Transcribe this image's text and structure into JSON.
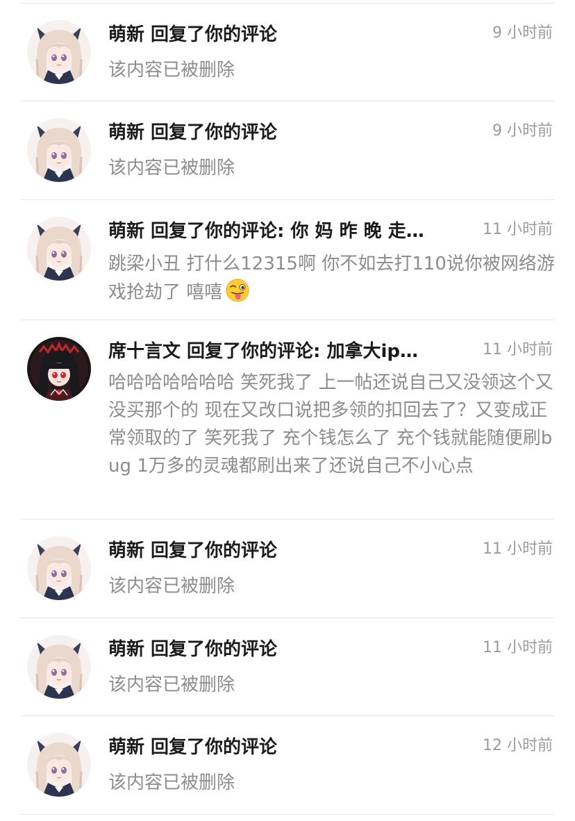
{
  "notifications": [
    {
      "title": "萌新 回复了你的评论",
      "time": "9 小时前",
      "body": "该内容已被删除",
      "avatar": "anime-girl-white-hair-avatar"
    },
    {
      "title": "萌新 回复了你的评论",
      "time": "9 小时前",
      "body": "该内容已被删除",
      "avatar": "anime-girl-white-hair-avatar"
    },
    {
      "title": "萌新 回复了你的评论: 你 妈 昨 晚 走…",
      "time": "11 小时前",
      "body": "跳梁小丑 打什么12315啊 你不如去打110说你被网络游戏抢劫了 嘻嘻",
      "emoji": "winking-tongue-emoji",
      "avatar": "anime-girl-white-hair-avatar"
    },
    {
      "title": "席十言文 回复了你的评论: 加拿大ip…",
      "time": "11 小时前",
      "body": "哈哈哈哈哈哈哈 笑死我了 上一帖还说自己又没领这个又没买那个的 现在又改口说把多领的扣回去了？又变成正常领取的了 笑死我了 充个钱怎么了 充个钱就能随便刷bug 1万多的灵魂都刷出来了还说自己不小心点",
      "avatar": "anime-girl-black-hair-avatar"
    },
    {
      "title": "萌新 回复了你的评论",
      "time": "11 小时前",
      "body": "该内容已被删除",
      "avatar": "anime-girl-white-hair-avatar"
    },
    {
      "title": "萌新 回复了你的评论",
      "time": "11 小时前",
      "body": "该内容已被删除",
      "avatar": "anime-girl-white-hair-avatar"
    },
    {
      "title": "萌新 回复了你的评论",
      "time": "12 小时前",
      "body": "该内容已被删除",
      "avatar": "anime-girl-white-hair-avatar"
    }
  ],
  "colors": {
    "title": "#1a1a1a",
    "body": "#8c8c8c",
    "time": "#9a9a9a",
    "divider": "#e3e3e3"
  }
}
